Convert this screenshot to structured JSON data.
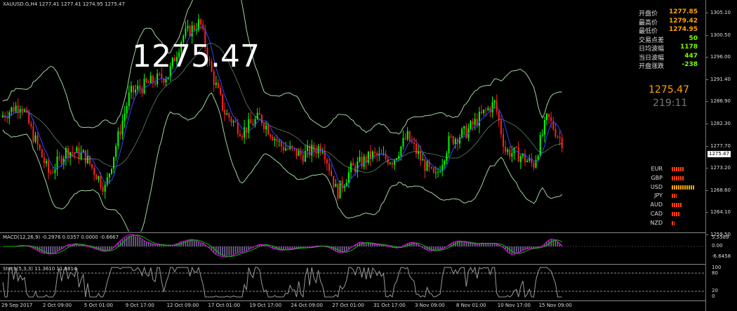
{
  "chart_header": {
    "symbol_text": "XAUUSD.G,H4  1277.41 1277.41 1274.95 1275.47"
  },
  "big_price": "1275.47",
  "right_axis_prices": [
    "1305.10",
    "1300.50",
    "1296.00",
    "1291.40",
    "1286.90",
    "1282.30",
    "1277.70",
    "1273.20",
    "1268.60",
    "1264.10",
    "1259.50"
  ],
  "current_price_tag": "1275.47",
  "info_panel": {
    "rows": [
      {
        "label": "开盘价",
        "value": "1277.85",
        "color": "#ffa500"
      },
      {
        "label": "最高价",
        "value": "1279.42",
        "color": "#ffa500"
      },
      {
        "label": "最低价",
        "value": "1274.95",
        "color": "#ffa500"
      },
      {
        "label": "交易点差",
        "value": "50",
        "color": "#7cfc00"
      },
      {
        "label": "日均波幅",
        "value": "1178",
        "color": "#7cfc00"
      },
      {
        "label": "当日波幅",
        "value": "447",
        "color": "#7cfc00"
      },
      {
        "label": "开盘涨跌",
        "value": "-238",
        "color": "#7cfc00"
      }
    ],
    "price": "1275.47",
    "timer": "219:11"
  },
  "currency_strength": [
    {
      "name": "EUR",
      "level": 5
    },
    {
      "name": "GBP",
      "level": 5
    },
    {
      "name": "USD",
      "level": 9
    },
    {
      "name": "JPY",
      "level": 2
    },
    {
      "name": "AUD",
      "level": 4
    },
    {
      "name": "CAD",
      "level": 3
    },
    {
      "name": "NZD",
      "level": 1
    }
  ],
  "macd": {
    "label": "MACD(12,26,9) -0.2976 0.0357 0.0000 -0.6667",
    "axis": [
      "5.5589",
      "0.00",
      "-6.6458"
    ]
  },
  "stoch": {
    "label": "Stoch(5,3,3) 11.3610 11.6814",
    "axis": [
      "100",
      "80",
      "20",
      "0"
    ]
  },
  "x_axis_labels": [
    "29 Sep 2017",
    "2 Oct 09:00",
    "5 Oct 01:00",
    "9 Oct 17:00",
    "12 Oct 09:00",
    "17 Oct 01:00",
    "19 Oct 17:00",
    "24 Oct 09:00",
    "27 Oct 01:00",
    "31 Oct 17:00",
    "3 Nov 09:00",
    "8 Nov 01:00",
    "10 Nov 17:00",
    "15 Nov 09:00"
  ],
  "colors": {
    "bull": "#00ff00",
    "bear": "#ff2222",
    "band": "#9fd59f",
    "ma": "#3344ff",
    "grid": "#555555",
    "macd_line": "#ff00ff",
    "signal_line": "#00c000",
    "stoch_line": "#999999"
  }
}
